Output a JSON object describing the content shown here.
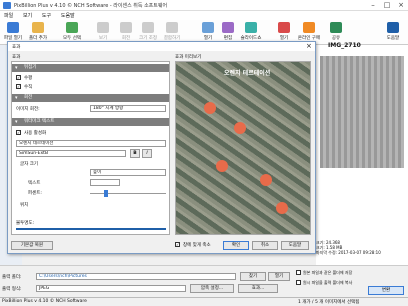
{
  "window": {
    "title": "PixBillion Plus v 4.10 © NCH Software - 라이센스 취득 소프트웨어"
  },
  "menu": [
    "파일",
    "보기",
    "도구",
    "도움말"
  ],
  "toolbar": {
    "items": [
      "파일 열기",
      "폴더 추가",
      "모두 선택",
      "보기",
      "회전",
      "크기 조정",
      "결합하기",
      "열기",
      "편집",
      "슬라이드쇼",
      "열기",
      "온라인 구매",
      "공유",
      "도움말"
    ]
  },
  "dialog": {
    "title": "효과",
    "list_header": "효과",
    "preview_header": "효과 미리보기",
    "sections": {
      "flip": "뒤집기",
      "rotate": "회전",
      "watermark": "워터마크 텍스트"
    },
    "flip": {
      "horizontal": "수평",
      "vertical": "수직"
    },
    "rotate": {
      "label": "이미지 회전:",
      "value": "180° 시계 방향"
    },
    "watermark": {
      "enable": "사용 활성화",
      "text": "오렌지 테르테이션",
      "font": "SimSun-ExtB",
      "bold": "B",
      "italic": "I",
      "font_size": "글자 크기",
      "size_option": "높이",
      "size_label": "텍스트",
      "percent": "퍼센트:",
      "position": "위치",
      "transparency": "불투명도:"
    },
    "reset_button": "기본값 복원",
    "preview_checkbox": "창에 맞게 축소",
    "ok": "확인",
    "cancel": "취소",
    "help": "도움말",
    "preview_watermark": "오렌지 테르테이션"
  },
  "image_info": {
    "filename": "IMG_2710",
    "size": "크기: 24.368",
    "dims": "크기: 1.58 MB",
    "date": "마지막 수정: 2017-03-07 09:28:10"
  },
  "bottom": {
    "output_folder_label": "출력 폴더:",
    "output_path": "C:\\Users\\nch\\Pictures",
    "browse": "찾기",
    "open": "열기",
    "output_format_label": "출력 형식:",
    "format": "JPEG",
    "compress": "압축 설정...",
    "effect_button": "효과...",
    "convert_button": "변환",
    "check1": "원본 파일과 같은 폴더에 저장",
    "check2": "원시 파일을 출력 폴더에 복사"
  },
  "status": {
    "left": "PixBillion Plus v 4.10 © NCH Software",
    "right": "1 개가 / 5 개 이미지에서 선택됨"
  },
  "colors": {
    "accent": "#1f5fa8",
    "section": "#7d7d7d"
  }
}
